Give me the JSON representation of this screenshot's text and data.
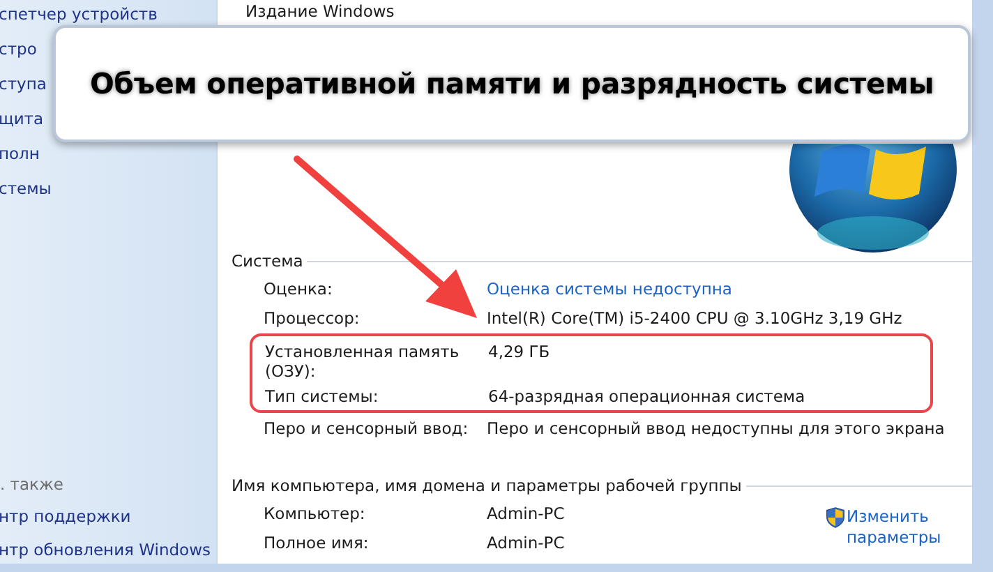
{
  "sidebar": {
    "top_items": [
      "спетчер устройств",
      "стро",
      "ступа",
      "щита",
      "полн",
      "стемы"
    ],
    "see_also": {
      "title": ". также",
      "links": [
        "нтр поддержки",
        "нтр обновления Windows"
      ]
    }
  },
  "edition_heading": "Издание Windows",
  "banner": {
    "text": "Объем оперативной памяти и разрядность системы"
  },
  "system": {
    "title": "Система",
    "rows": [
      {
        "label": "Оценка:",
        "value": "Оценка системы недоступна",
        "kind": "link",
        "highlighted": false
      },
      {
        "label": "Процессор:",
        "value": "Intel(R) Core(TM) i5-2400 CPU @ 3.10GHz   3,19 GHz",
        "kind": "text",
        "highlighted": false
      },
      {
        "label": "Установленная память (ОЗУ):",
        "value": "4,29 ГБ",
        "kind": "text",
        "highlighted": true
      },
      {
        "label": "Тип системы:",
        "value": "64-разрядная операционная система",
        "kind": "text",
        "highlighted": true
      },
      {
        "label": "Перо и сенсорный ввод:",
        "value": "Перо и сенсорный ввод недоступны для этого экрана",
        "kind": "text",
        "highlighted": false
      }
    ]
  },
  "computer": {
    "title": "Имя компьютера, имя домена и параметры рабочей группы",
    "rows": [
      {
        "label": "Компьютер:",
        "value": "Admin-PC"
      },
      {
        "label": "Полное имя:",
        "value": "Admin-PC"
      }
    ],
    "change_link": "Изменить параметры"
  }
}
